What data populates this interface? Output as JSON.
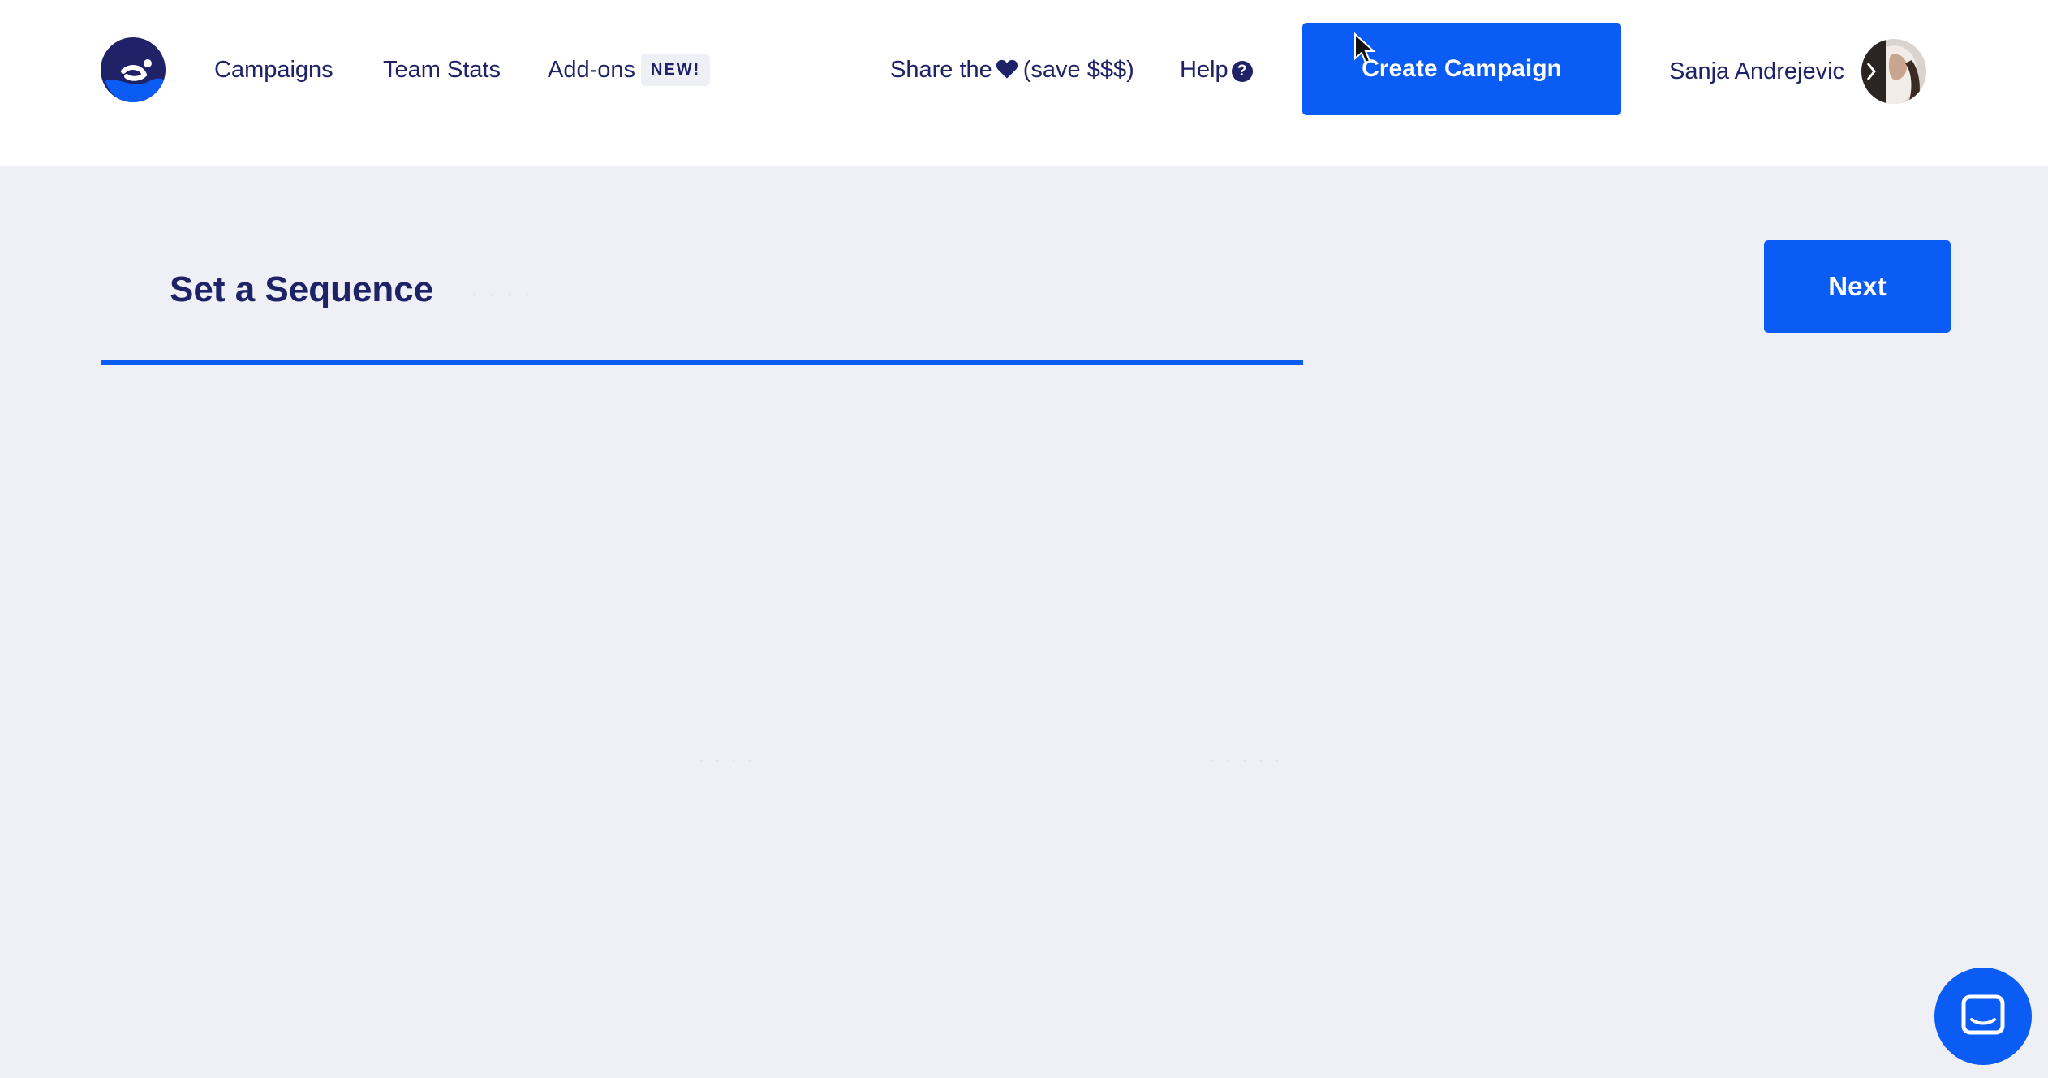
{
  "nav": {
    "links": [
      {
        "label": "Campaigns"
      },
      {
        "label": "Team Stats"
      },
      {
        "label": "Add-ons"
      }
    ],
    "new_badge": "NEW!",
    "share_prefix": "Share the",
    "share_suffix": "(save $$$)",
    "help_label": "Help",
    "create_campaign_label": "Create Campaign",
    "user_name": "Sanja Andrejevic"
  },
  "wizard": {
    "step_title": "Set a Sequence",
    "next_label": "Next"
  },
  "colors": {
    "brand_blue": "#0a5cf5",
    "navy": "#1f2266",
    "page_bg": "#eef0f5"
  },
  "icons": [
    "logo-icon",
    "heart-icon",
    "question-icon",
    "avatar",
    "chat-icon",
    "mouse-cursor-icon"
  ]
}
